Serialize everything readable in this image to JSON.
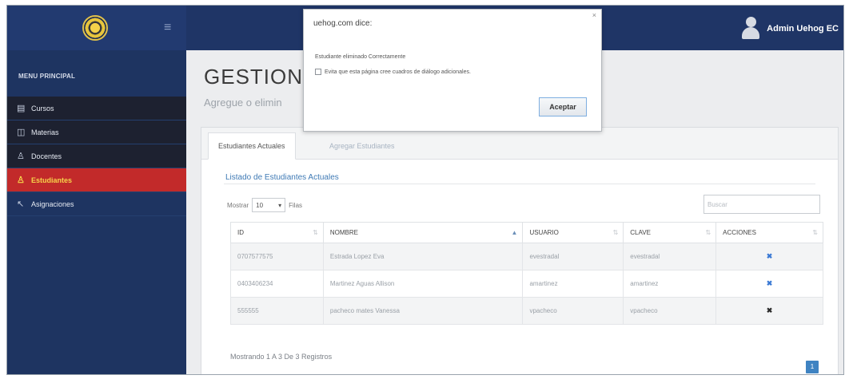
{
  "header": {
    "user_name": "Admin Uehog EC",
    "logo_icon": "seal-logo",
    "menu_icon": "hamburger-icon",
    "colors": {
      "topbar": "#1f3566",
      "sidebar": "#1e3461",
      "active": "#c22a2a"
    }
  },
  "sidebar": {
    "title": "MENU PRINCIPAL",
    "items": [
      {
        "label": "Cursos",
        "icon": "calendar-icon",
        "glyph": "▤"
      },
      {
        "label": "Materias",
        "icon": "book-icon",
        "glyph": "◫"
      },
      {
        "label": "Docentes",
        "icon": "user-icon",
        "glyph": "♙"
      },
      {
        "label": "Estudiantes",
        "icon": "user-icon",
        "glyph": "♙"
      },
      {
        "label": "Asignaciones",
        "icon": "link-icon",
        "glyph": "↖"
      }
    ],
    "active_index": 3
  },
  "main": {
    "title": "GESTION",
    "subtitle": "Agregue o elimin",
    "tabs": [
      {
        "label": "Estudiantes Actuales"
      },
      {
        "label": "Agregar Estudiantes"
      }
    ],
    "list_title": "Listado de Estudiantes Actuales",
    "length_prefix": "Mostrar",
    "length_value": "10",
    "length_suffix": "Filas",
    "search_placeholder": "Buscar",
    "columns": [
      "ID",
      "NOMBRE",
      "USUARIO",
      "CLAVE",
      "ACCIONES"
    ],
    "rows": [
      {
        "id": "0707577575",
        "nombre": "Estrada Lopez Eva",
        "usuario": "evestradal",
        "clave": "evestradal",
        "accion": "✖"
      },
      {
        "id": "0403406234",
        "nombre": "Martinez Aguas Allison",
        "usuario": "amartinez",
        "clave": "amartinez",
        "accion": "✖"
      },
      {
        "id": "555555",
        "nombre": "pacheco mates Vanessa",
        "usuario": "vpacheco",
        "clave": "vpacheco",
        "accion": "✖"
      }
    ],
    "info": "Mostrando 1 A 3 De 3 Registros",
    "page": "1"
  },
  "dialog": {
    "title": "uehog.com dice:",
    "close": "×",
    "message": "Estudiante eliminado Correctamente",
    "checkbox_label": "Evita que esta página cree cuadros de diálogo adicionales.",
    "ok_label": "Aceptar"
  }
}
